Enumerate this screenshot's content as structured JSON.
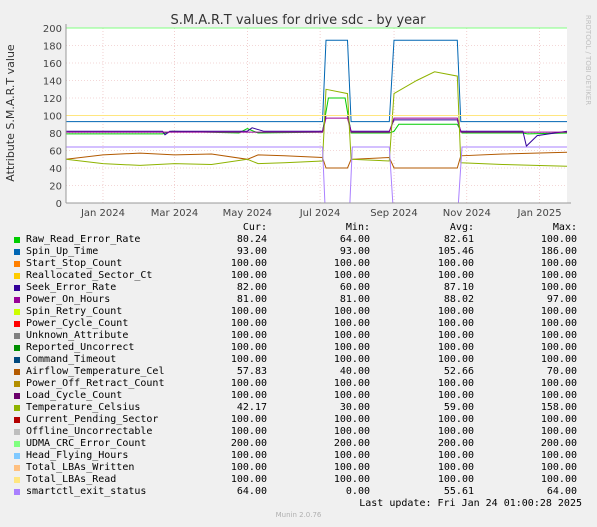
{
  "chart_data": {
    "type": "line",
    "title": "S.M.A.R.T values for drive sdc - by year",
    "ylabel": "Attribute S.M.A.R.T value",
    "side_label": "RRDTOOL / TOBI OETIKER",
    "ylim": [
      0,
      200
    ],
    "yticks": [
      0,
      20,
      40,
      60,
      80,
      100,
      120,
      140,
      160,
      180,
      200
    ],
    "xlim": [
      "2023-12-01",
      "2025-01-24"
    ],
    "xticks": [
      {
        "label": "Jan 2024",
        "date": "2024-01-01"
      },
      {
        "label": "Mar 2024",
        "date": "2024-03-01"
      },
      {
        "label": "May 2024",
        "date": "2024-05-01"
      },
      {
        "label": "Jul 2024",
        "date": "2024-07-01"
      },
      {
        "label": "Sep 2024",
        "date": "2024-09-01"
      },
      {
        "label": "Nov 2024",
        "date": "2024-11-01"
      },
      {
        "label": "Jan 2025",
        "date": "2025-01-01"
      }
    ],
    "grid": true,
    "series": [
      {
        "name": "Raw_Read_Error_Rate",
        "color": "#00cc00",
        "cur": "80.24",
        "min": "64.00",
        "avg": "82.61",
        "max": "100.00",
        "points": [
          [
            "2023-12-01",
            79
          ],
          [
            "2024-02-20",
            79
          ],
          [
            "2024-02-28",
            82
          ],
          [
            "2024-04-24",
            80
          ],
          [
            "2024-05-01",
            85
          ],
          [
            "2024-05-10",
            80
          ],
          [
            "2024-07-03",
            81
          ],
          [
            "2024-07-08",
            120
          ],
          [
            "2024-07-22",
            120
          ],
          [
            "2024-07-27",
            80
          ],
          [
            "2024-08-28",
            80
          ],
          [
            "2024-09-01",
            82
          ],
          [
            "2024-09-05",
            90
          ],
          [
            "2024-10-24",
            90
          ],
          [
            "2024-10-28",
            80
          ],
          [
            "2024-12-18",
            80
          ],
          [
            "2024-12-22",
            79
          ],
          [
            "2025-01-24",
            80
          ]
        ]
      },
      {
        "name": "Spin_Up_Time",
        "color": "#0066b3",
        "cur": "93.00",
        "min": "93.00",
        "avg": "105.46",
        "max": "186.00",
        "points": [
          [
            "2023-12-01",
            93
          ],
          [
            "2024-07-03",
            93
          ],
          [
            "2024-07-06",
            186
          ],
          [
            "2024-07-24",
            186
          ],
          [
            "2024-07-27",
            93
          ],
          [
            "2024-08-28",
            93
          ],
          [
            "2024-09-01",
            186
          ],
          [
            "2024-10-24",
            186
          ],
          [
            "2024-10-27",
            93
          ],
          [
            "2025-01-24",
            93
          ]
        ]
      },
      {
        "name": "Start_Stop_Count",
        "color": "#ff8000",
        "cur": "100.00",
        "min": "100.00",
        "avg": "100.00",
        "max": "100.00",
        "points": [
          [
            "2023-12-01",
            100
          ],
          [
            "2025-01-24",
            100
          ]
        ]
      },
      {
        "name": "Reallocated_Sector_Ct",
        "color": "#ffcc00",
        "cur": "100.00",
        "min": "100.00",
        "avg": "100.00",
        "max": "100.00",
        "points": [
          [
            "2023-12-01",
            100
          ],
          [
            "2025-01-24",
            100
          ]
        ]
      },
      {
        "name": "Seek_Error_Rate",
        "color": "#330099",
        "cur": "82.00",
        "min": "60.00",
        "avg": "87.10",
        "max": "100.00",
        "points": [
          [
            "2023-12-01",
            82
          ],
          [
            "2024-02-20",
            82
          ],
          [
            "2024-02-22",
            78
          ],
          [
            "2024-02-26",
            82
          ],
          [
            "2024-05-01",
            82
          ],
          [
            "2024-05-05",
            86
          ],
          [
            "2024-05-15",
            82
          ],
          [
            "2024-07-03",
            82
          ],
          [
            "2024-07-06",
            100
          ],
          [
            "2024-07-24",
            100
          ],
          [
            "2024-07-27",
            82
          ],
          [
            "2024-08-28",
            82
          ],
          [
            "2024-09-01",
            95
          ],
          [
            "2024-10-24",
            95
          ],
          [
            "2024-10-27",
            82
          ],
          [
            "2024-12-18",
            82
          ],
          [
            "2024-12-21",
            65
          ],
          [
            "2024-12-30",
            77
          ],
          [
            "2025-01-24",
            82
          ]
        ]
      },
      {
        "name": "Power_On_Hours",
        "color": "#990099",
        "cur": "81.00",
        "min": "81.00",
        "avg": "88.02",
        "max": "97.00",
        "points": [
          [
            "2023-12-01",
            81
          ],
          [
            "2024-07-03",
            81
          ],
          [
            "2024-07-06",
            97
          ],
          [
            "2024-07-24",
            97
          ],
          [
            "2024-07-27",
            81
          ],
          [
            "2024-08-28",
            81
          ],
          [
            "2024-09-01",
            97
          ],
          [
            "2024-10-24",
            97
          ],
          [
            "2024-10-27",
            81
          ],
          [
            "2025-01-24",
            81
          ]
        ]
      },
      {
        "name": "Spin_Retry_Count",
        "color": "#ccff00",
        "cur": "100.00",
        "min": "100.00",
        "avg": "100.00",
        "max": "100.00",
        "points": [
          [
            "2023-12-01",
            100
          ],
          [
            "2025-01-24",
            100
          ]
        ]
      },
      {
        "name": "Power_Cycle_Count",
        "color": "#ff0000",
        "cur": "100.00",
        "min": "100.00",
        "avg": "100.00",
        "max": "100.00",
        "points": [
          [
            "2023-12-01",
            100
          ],
          [
            "2025-01-24",
            100
          ]
        ]
      },
      {
        "name": "Unknown_Attribute",
        "color": "#808080",
        "cur": "100.00",
        "min": "100.00",
        "avg": "100.00",
        "max": "100.00",
        "points": [
          [
            "2023-12-01",
            100
          ],
          [
            "2025-01-24",
            100
          ]
        ]
      },
      {
        "name": "Reported_Uncorrect",
        "color": "#008f00",
        "cur": "100.00",
        "min": "100.00",
        "avg": "100.00",
        "max": "100.00",
        "points": [
          [
            "2023-12-01",
            100
          ],
          [
            "2025-01-24",
            100
          ]
        ]
      },
      {
        "name": "Command_Timeout",
        "color": "#00487d",
        "cur": "100.00",
        "min": "100.00",
        "avg": "100.00",
        "max": "100.00",
        "points": [
          [
            "2023-12-01",
            100
          ],
          [
            "2025-01-24",
            100
          ]
        ]
      },
      {
        "name": "Airflow_Temperature_Cel",
        "color": "#b35a00",
        "cur": "57.83",
        "min": "40.00",
        "avg": "52.66",
        "max": "70.00",
        "points": [
          [
            "2023-12-01",
            50
          ],
          [
            "2024-01-01",
            55
          ],
          [
            "2024-02-01",
            57
          ],
          [
            "2024-03-01",
            55
          ],
          [
            "2024-04-01",
            56
          ],
          [
            "2024-05-01",
            50
          ],
          [
            "2024-05-10",
            55
          ],
          [
            "2024-06-01",
            54
          ],
          [
            "2024-07-03",
            52
          ],
          [
            "2024-07-06",
            40
          ],
          [
            "2024-07-24",
            40
          ],
          [
            "2024-07-27",
            50
          ],
          [
            "2024-08-28",
            52
          ],
          [
            "2024-09-01",
            40
          ],
          [
            "2024-10-24",
            40
          ],
          [
            "2024-10-27",
            54
          ],
          [
            "2024-12-01",
            56
          ],
          [
            "2025-01-24",
            58
          ]
        ]
      },
      {
        "name": "Power_Off_Retract_Count",
        "color": "#b38f00",
        "cur": "100.00",
        "min": "100.00",
        "avg": "100.00",
        "max": "100.00",
        "points": [
          [
            "2023-12-01",
            100
          ],
          [
            "2025-01-24",
            100
          ]
        ]
      },
      {
        "name": "Load_Cycle_Count",
        "color": "#6b006b",
        "cur": "100.00",
        "min": "100.00",
        "avg": "100.00",
        "max": "100.00",
        "points": [
          [
            "2023-12-01",
            100
          ],
          [
            "2025-01-24",
            100
          ]
        ]
      },
      {
        "name": "Temperature_Celsius",
        "color": "#8fb300",
        "cur": "42.17",
        "min": "30.00",
        "avg": "59.00",
        "max": "158.00",
        "points": [
          [
            "2023-12-01",
            50
          ],
          [
            "2024-01-01",
            45
          ],
          [
            "2024-02-01",
            43
          ],
          [
            "2024-03-01",
            45
          ],
          [
            "2024-04-01",
            44
          ],
          [
            "2024-05-01",
            50
          ],
          [
            "2024-05-10",
            45
          ],
          [
            "2024-06-01",
            46
          ],
          [
            "2024-07-03",
            48
          ],
          [
            "2024-07-06",
            130
          ],
          [
            "2024-07-24",
            125
          ],
          [
            "2024-07-27",
            50
          ],
          [
            "2024-08-28",
            48
          ],
          [
            "2024-09-01",
            125
          ],
          [
            "2024-09-20",
            140
          ],
          [
            "2024-10-05",
            150
          ],
          [
            "2024-10-24",
            145
          ],
          [
            "2024-10-27",
            46
          ],
          [
            "2024-12-01",
            44
          ],
          [
            "2025-01-24",
            42
          ]
        ]
      },
      {
        "name": "Current_Pending_Sector",
        "color": "#b30000",
        "cur": "100.00",
        "min": "100.00",
        "avg": "100.00",
        "max": "100.00",
        "points": [
          [
            "2023-12-01",
            100
          ],
          [
            "2025-01-24",
            100
          ]
        ]
      },
      {
        "name": "Offline_Uncorrectable",
        "color": "#bebebe",
        "cur": "100.00",
        "min": "100.00",
        "avg": "100.00",
        "max": "100.00",
        "points": [
          [
            "2023-12-01",
            100
          ],
          [
            "2025-01-24",
            100
          ]
        ]
      },
      {
        "name": "UDMA_CRC_Error_Count",
        "color": "#80ff80",
        "cur": "200.00",
        "min": "200.00",
        "avg": "200.00",
        "max": "200.00",
        "points": [
          [
            "2023-12-01",
            200
          ],
          [
            "2025-01-24",
            200
          ]
        ]
      },
      {
        "name": "Head_Flying_Hours",
        "color": "#80c9ff",
        "cur": "100.00",
        "min": "100.00",
        "avg": "100.00",
        "max": "100.00",
        "points": [
          [
            "2023-12-01",
            100
          ],
          [
            "2025-01-24",
            100
          ]
        ]
      },
      {
        "name": "Total_LBAs_Written",
        "color": "#ffc080",
        "cur": "100.00",
        "min": "100.00",
        "avg": "100.00",
        "max": "100.00",
        "points": [
          [
            "2023-12-01",
            100
          ],
          [
            "2025-01-24",
            100
          ]
        ]
      },
      {
        "name": "Total_LBAs_Read",
        "color": "#ffe680",
        "cur": "100.00",
        "min": "100.00",
        "avg": "100.00",
        "max": "100.00",
        "points": [
          [
            "2023-12-01",
            100
          ],
          [
            "2025-01-24",
            100
          ]
        ]
      },
      {
        "name": "smartctl_exit_status",
        "color": "#aa80ff",
        "cur": "64.00",
        "min": "0.00",
        "avg": "55.61",
        "max": "64.00",
        "points": [
          [
            "2023-12-01",
            64
          ],
          [
            "2024-07-03",
            64
          ],
          [
            "2024-07-05",
            0
          ],
          [
            "2024-07-26",
            0
          ],
          [
            "2024-07-28",
            64
          ],
          [
            "2024-08-28",
            64
          ],
          [
            "2024-08-31",
            0
          ],
          [
            "2024-10-25",
            0
          ],
          [
            "2024-10-28",
            64
          ],
          [
            "2025-01-24",
            64
          ]
        ]
      }
    ]
  },
  "legend": {
    "headers": {
      "cur": "Cur:",
      "min": "Min:",
      "avg": "Avg:",
      "max": "Max:"
    },
    "last_update": "Last update: Fri Jan 24 01:00:28 2025",
    "footer": "Munin 2.0.76"
  }
}
